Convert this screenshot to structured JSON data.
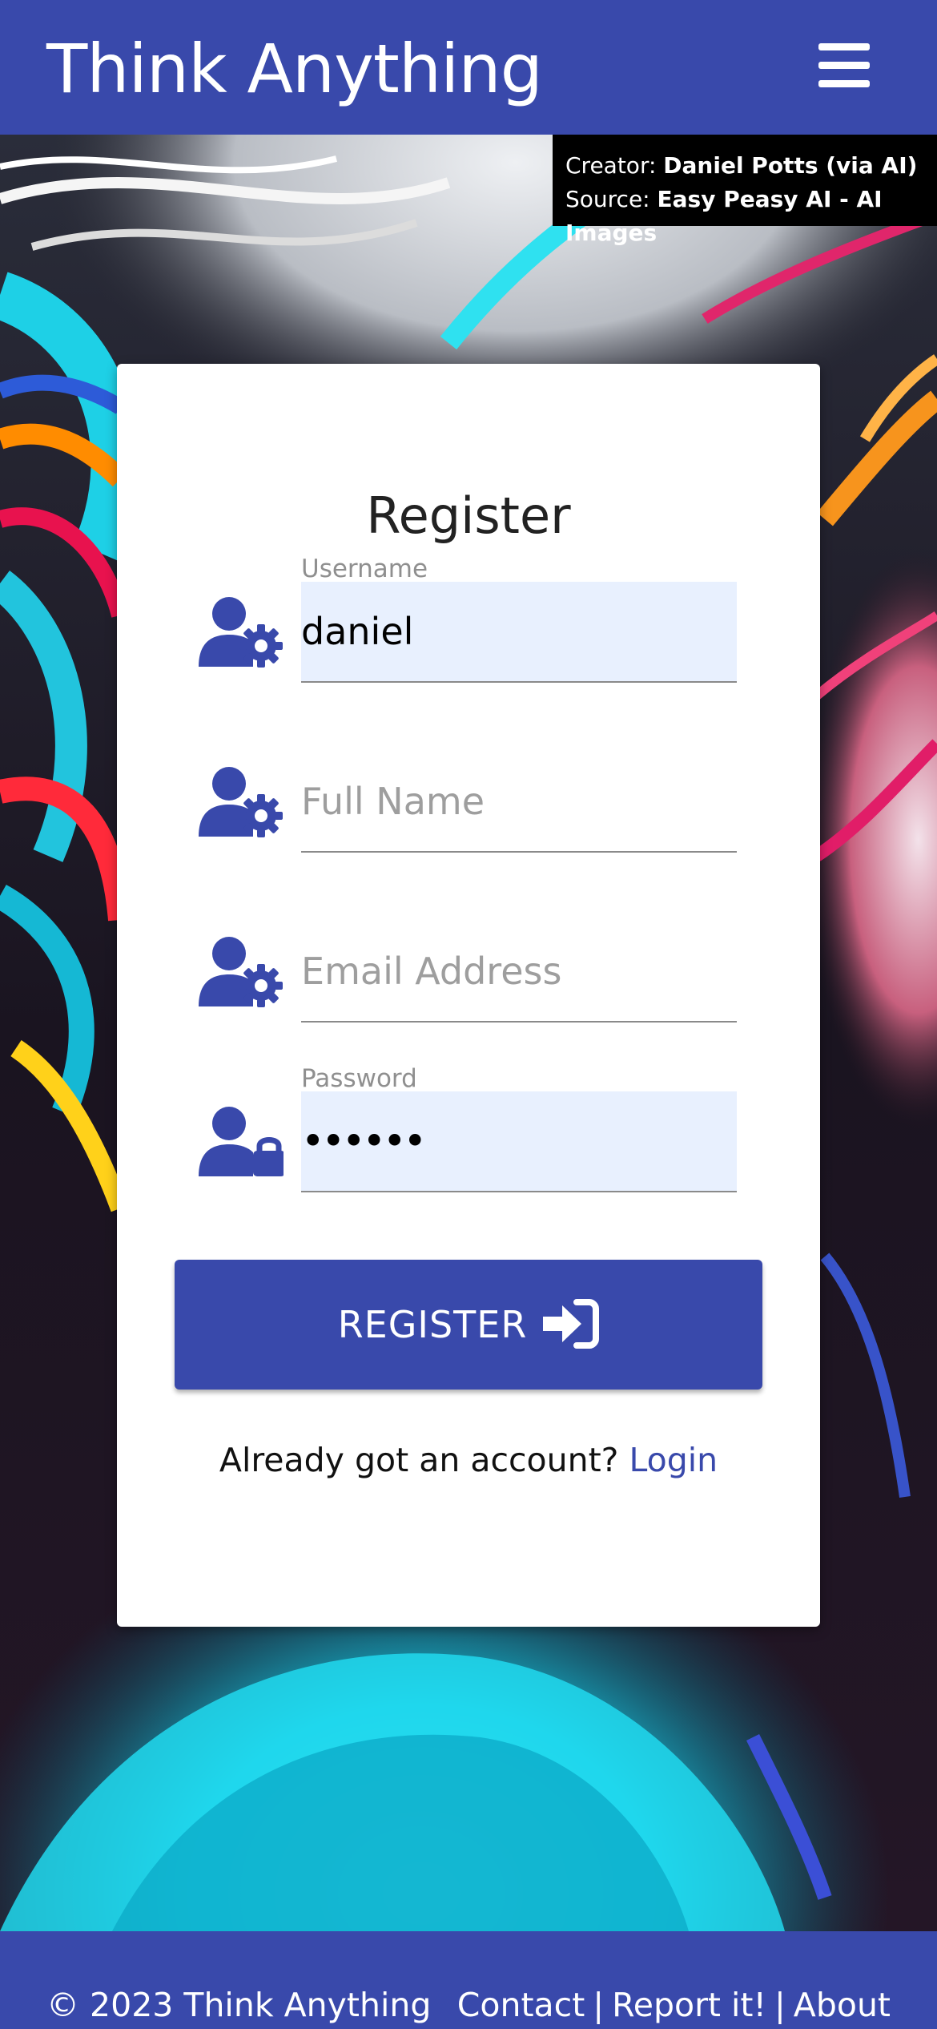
{
  "header": {
    "brand": "Think Anything",
    "menu_icon": "hamburger-menu-icon"
  },
  "credit": {
    "creator_label": "Creator: ",
    "creator_value": "Daniel Potts (via AI)",
    "source_label": "Source: ",
    "source_value": "Easy Peasy AI - AI Images"
  },
  "form": {
    "title": "Register",
    "username": {
      "label": "Username",
      "value": "daniel",
      "icon": "user-gear-icon"
    },
    "full_name": {
      "placeholder": "Full Name",
      "icon": "user-gear-icon"
    },
    "email": {
      "placeholder": "Email Address",
      "icon": "user-gear-icon"
    },
    "password": {
      "label": "Password",
      "value": "••••••",
      "icon": "user-lock-icon"
    },
    "submit_label": "REGISTER",
    "submit_icon": "sign-in-icon",
    "login_prompt": "Already got an account?",
    "login_link": "Login"
  },
  "footer": {
    "copyright": "© 2023 Think Anything",
    "links": [
      "Contact",
      "Report it!",
      "About"
    ],
    "separator": "|"
  },
  "colors": {
    "primary": "#3949ab",
    "autofill_bg": "#e8f0fe",
    "card_bg": "#ffffff"
  }
}
